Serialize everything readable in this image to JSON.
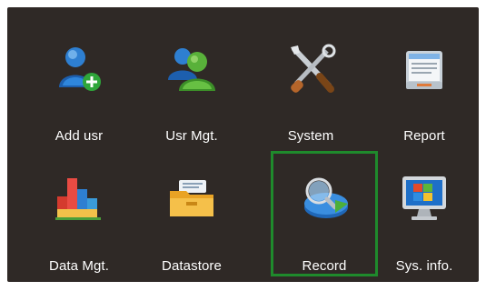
{
  "menu": {
    "items": [
      {
        "label": "Add usr",
        "icon": "add-user-icon"
      },
      {
        "label": "Usr Mgt.",
        "icon": "users-icon"
      },
      {
        "label": "System",
        "icon": "tools-icon"
      },
      {
        "label": "Report",
        "icon": "report-icon"
      },
      {
        "label": "Data Mgt.",
        "icon": "bar-chart-icon"
      },
      {
        "label": "Datastore",
        "icon": "folder-icon"
      },
      {
        "label": "Record",
        "icon": "search-record-icon"
      },
      {
        "label": "Sys. info.",
        "icon": "monitor-icon"
      }
    ],
    "selected": "Record"
  },
  "colors": {
    "background": "#2f2926",
    "selection": "#1f8a2c",
    "label": "#ffffff"
  }
}
